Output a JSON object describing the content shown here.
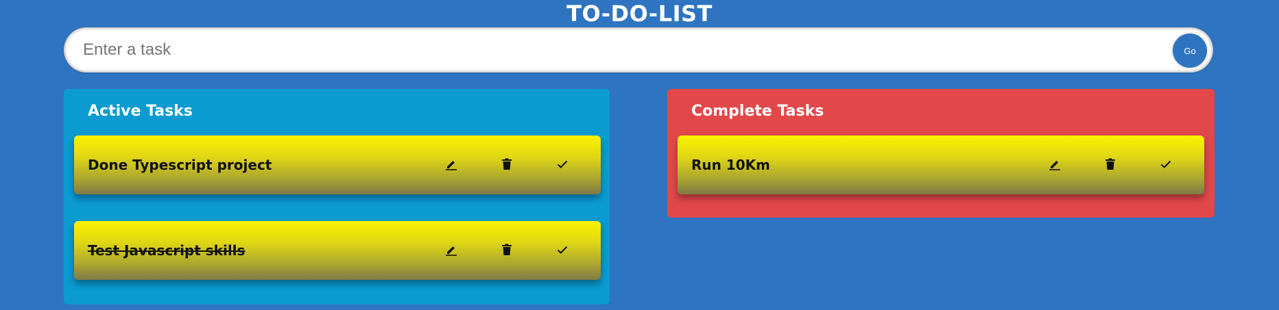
{
  "header": {
    "title": "TO-DO-LIST"
  },
  "search": {
    "placeholder": "Enter a task",
    "value": "",
    "submit_label": "Go"
  },
  "panels": {
    "active": {
      "heading": "Active Tasks",
      "color": "#0b9bd1",
      "tasks": [
        {
          "text": "Done Typescript project",
          "done": false
        },
        {
          "text": "Test Javascript skills",
          "done": true
        }
      ]
    },
    "complete": {
      "heading": "Complete Tasks",
      "color": "#e2484a",
      "tasks": [
        {
          "text": "Run 10Km",
          "done": false
        }
      ]
    }
  },
  "task_actions": [
    "edit-icon",
    "delete-icon",
    "check-icon"
  ],
  "colors": {
    "background": "#2f74c0",
    "card_top": "#fbf200",
    "card_bottom": "#7f7a46"
  }
}
